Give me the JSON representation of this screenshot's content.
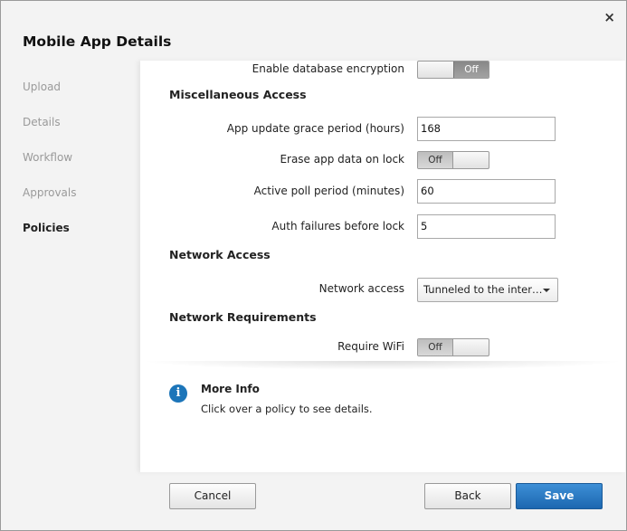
{
  "dialog": {
    "title": "Mobile App Details",
    "close_symbol": "×"
  },
  "sidebar": {
    "items": [
      {
        "label": "Upload",
        "active": false
      },
      {
        "label": "Details",
        "active": false
      },
      {
        "label": "Workflow",
        "active": false
      },
      {
        "label": "Approvals",
        "active": false
      },
      {
        "label": "Policies",
        "active": true
      }
    ]
  },
  "policies": {
    "partial_row": {
      "label": "Enable database encryption",
      "value": "Off"
    },
    "misc_section": "Miscellaneous Access",
    "grace_period": {
      "label": "App update grace period (hours)",
      "value": "168"
    },
    "erase_data": {
      "label": "Erase app data on lock",
      "value": "Off"
    },
    "poll_period": {
      "label": "Active poll period (minutes)",
      "value": "60"
    },
    "auth_failures": {
      "label": "Auth failures before lock",
      "value": "5"
    },
    "network_section": "Network Access",
    "network_access": {
      "label": "Network access",
      "value": "Tunneled to the inter…"
    },
    "requirements_section": "Network Requirements",
    "require_wifi": {
      "label": "Require WiFi",
      "value": "Off"
    }
  },
  "info": {
    "icon": "info-icon",
    "title": "More Info",
    "text": "Click over a policy to see details."
  },
  "footer": {
    "cancel": "Cancel",
    "back": "Back",
    "save": "Save"
  },
  "colors": {
    "primary_button": "#1c67b0",
    "info_icon": "#1c75b9"
  }
}
